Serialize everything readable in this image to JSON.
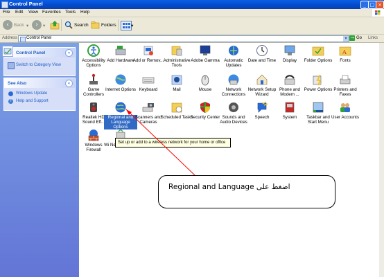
{
  "window": {
    "title": "Control Panel"
  },
  "menu": [
    "File",
    "Edit",
    "View",
    "Favorites",
    "Tools",
    "Help"
  ],
  "toolbar": {
    "back_label": "Back",
    "search_label": "Search",
    "folders_label": "Folders"
  },
  "address": {
    "label": "Address",
    "value": "Control Panel",
    "go_label": "Go",
    "links_label": "Links"
  },
  "sidebar": {
    "panel1": {
      "title": "Control Panel",
      "link": "Switch to Category View"
    },
    "panel2": {
      "title": "See Also",
      "links": [
        "Windows Update",
        "Help and Support"
      ]
    }
  },
  "items": [
    {
      "label": "Accessibility Options",
      "icon": "accessibility-icon"
    },
    {
      "label": "Add Hardware",
      "icon": "add-hardware-icon"
    },
    {
      "label": "Add or Remov...",
      "icon": "add-remove-programs-icon"
    },
    {
      "label": "Administrative Tools",
      "icon": "admin-tools-icon"
    },
    {
      "label": "Adobe Gamma",
      "icon": "adobe-gamma-icon"
    },
    {
      "label": "Automatic Updates",
      "icon": "automatic-updates-icon"
    },
    {
      "label": "Date and Time",
      "icon": "clock-icon"
    },
    {
      "label": "Display",
      "icon": "display-icon"
    },
    {
      "label": "Folder Options",
      "icon": "folder-options-icon"
    },
    {
      "label": "Fonts",
      "icon": "fonts-folder-icon"
    },
    {
      "label": "Game Controllers",
      "icon": "joystick-icon"
    },
    {
      "label": "Internet Options",
      "icon": "internet-globe-icon"
    },
    {
      "label": "Keyboard",
      "icon": "keyboard-icon"
    },
    {
      "label": "Mail",
      "icon": "mail-icon"
    },
    {
      "label": "Mouse",
      "icon": "mouse-icon"
    },
    {
      "label": "Network Connections",
      "icon": "network-connections-icon"
    },
    {
      "label": "Network Setup Wizard",
      "icon": "network-setup-house-icon"
    },
    {
      "label": "Phone and Modem ...",
      "icon": "phone-modem-icon"
    },
    {
      "label": "Power Options",
      "icon": "power-icon"
    },
    {
      "label": "Printers and Faxes",
      "icon": "printer-icon"
    },
    {
      "label": "Realtek HD Sound Eff...",
      "icon": "speaker-icon"
    },
    {
      "label": "Regional and Language Options",
      "icon": "regional-globe-icon"
    },
    {
      "label": "Scanners and Cameras",
      "icon": "scanner-camera-icon"
    },
    {
      "label": "Scheduled Tasks",
      "icon": "scheduled-tasks-icon"
    },
    {
      "label": "Security Center",
      "icon": "security-shield-icon"
    },
    {
      "label": "Sounds and Audio Devices",
      "icon": "sounds-audio-icon"
    },
    {
      "label": "Speech",
      "icon": "speech-icon"
    },
    {
      "label": "System",
      "icon": "system-computer-icon"
    },
    {
      "label": "Taskbar and Start Menu",
      "icon": "taskbar-icon"
    },
    {
      "label": "User Accounts",
      "icon": "users-icon"
    },
    {
      "label": "Windows Firewall",
      "icon": "firewall-icon"
    },
    {
      "label": "Wi Network Set...",
      "icon": "wireless-network-icon"
    }
  ],
  "tooltip": "Set up or add to a wireless network for your home or office",
  "callout": "اضغط على Regional and Language",
  "colors": {
    "accent": "#316ac5",
    "arrow": "#ff0000",
    "sidebar": "#7ba2e7"
  }
}
